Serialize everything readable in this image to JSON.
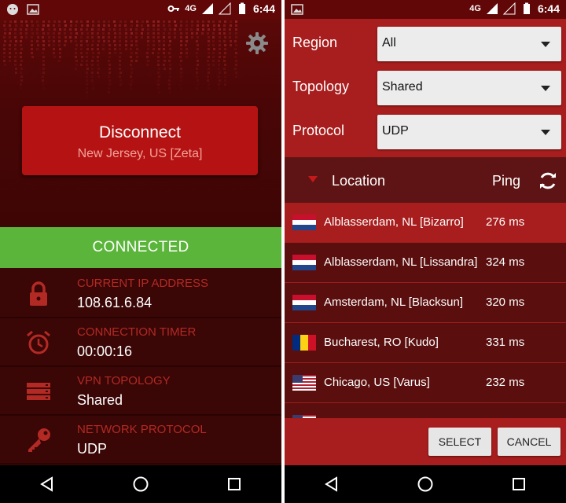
{
  "status_bar": {
    "network": "4G",
    "time": "6:44"
  },
  "left": {
    "disconnect_label": "Disconnect",
    "server_location": "New Jersey, US [Zeta]",
    "connection_status": "CONNECTED",
    "info": [
      {
        "label": "CURRENT IP ADDRESS",
        "value": "108.61.6.84",
        "icon": "lock-icon"
      },
      {
        "label": "CONNECTION TIMER",
        "value": "00:00:16",
        "icon": "alarm-clock-icon"
      },
      {
        "label": "VPN TOPOLOGY",
        "value": "Shared",
        "icon": "server-stack-icon"
      },
      {
        "label": "NETWORK PROTOCOL",
        "value": "UDP",
        "icon": "key-icon"
      }
    ]
  },
  "right": {
    "filters": [
      {
        "label": "Region",
        "value": "All"
      },
      {
        "label": "Topology",
        "value": "Shared"
      },
      {
        "label": "Protocol",
        "value": "UDP"
      }
    ],
    "header": {
      "location": "Location",
      "ping": "Ping"
    },
    "servers": [
      {
        "name": "Alblasserdam, NL [Bizarro]",
        "ping": "276 ms",
        "flag": "nl"
      },
      {
        "name": "Alblasserdam, NL [Lissandra]",
        "ping": "324 ms",
        "flag": "nl"
      },
      {
        "name": "Amsterdam, NL [Blacksun]",
        "ping": "320 ms",
        "flag": "nl"
      },
      {
        "name": "Bucharest, RO [Kudo]",
        "ping": "331 ms",
        "flag": "ro"
      },
      {
        "name": "Chicago, US [Varus]",
        "ping": "232 ms",
        "flag": "us"
      }
    ],
    "select_label": "SELECT",
    "cancel_label": "CANCEL"
  },
  "colors": {
    "accent_red": "#a81d1d",
    "dark_bg": "#3a0606",
    "connected_green": "#5ab53a",
    "label_red": "#b32a24"
  }
}
